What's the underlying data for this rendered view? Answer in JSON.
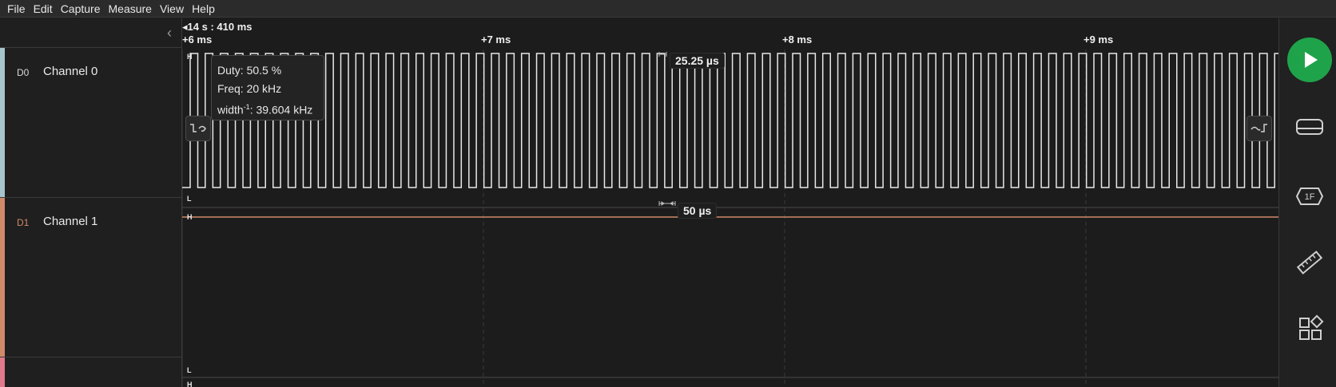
{
  "menu": [
    "File",
    "Edit",
    "Capture",
    "Measure",
    "View",
    "Help"
  ],
  "timeline": {
    "absolute_time": "14 s : 410 ms",
    "ticks": [
      "+6 ms",
      "+7 ms",
      "+8 ms",
      "+9 ms"
    ]
  },
  "channels": [
    {
      "id": "D0",
      "name": "Channel 0",
      "color": "#a8c4cc",
      "high_label": "H",
      "low_label": "L"
    },
    {
      "id": "D1",
      "name": "Channel 1",
      "color": "#d08a6a",
      "high_label": "H",
      "low_label": "L"
    }
  ],
  "next_channel_high_label": "H",
  "tooltip": {
    "duty": "Duty: 50.5 %",
    "freq": "Freq: 20 kHz",
    "width_prefix": "width",
    "width_exponent": "-1",
    "width_value": ": 39.604 kHz"
  },
  "measurements": {
    "pulse_width": "25.25 µs",
    "period": "50 µs"
  },
  "signal": {
    "frequency_khz": 20,
    "duty_percent": 50.5
  },
  "colors": {
    "play": "#1fa34a",
    "channel0_wave": "#e8e8e8",
    "channel1_wave": "#d08a6a"
  },
  "right_toolbar": [
    "play-icon",
    "analyzers-icon",
    "protocol-1f-icon",
    "ruler-icon",
    "extensions-icon"
  ]
}
